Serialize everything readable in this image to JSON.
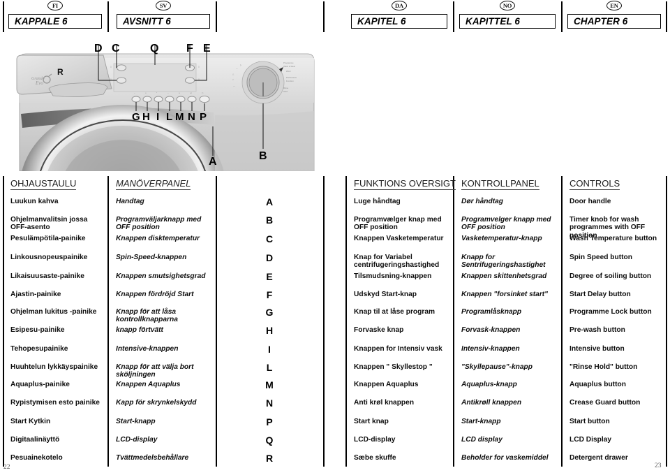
{
  "languages": [
    {
      "code": "FI",
      "title": "KAPPALE 6"
    },
    {
      "code": "SV",
      "title": "AVSNITT 6"
    },
    {
      "code": "DA",
      "title": "KAPITEL 6"
    },
    {
      "code": "NO",
      "title": "KAPITTEL 6"
    },
    {
      "code": "EN",
      "title": "CHAPTER 6"
    }
  ],
  "illustration": {
    "alt_name": "washing-machine-control-panel",
    "brand_label": "Grando Evo",
    "callouts": [
      "D",
      "C",
      "Q",
      "F",
      "E",
      "R",
      "G",
      "H",
      "I",
      "L",
      "M",
      "N",
      "P",
      "B",
      "A"
    ]
  },
  "section_headers": {
    "fi": "OHJAUSTAULU",
    "sv": "MANÖVERPANEL",
    "da": "FUNKTIONS OVERSIGT",
    "no": "KONTROLLPANEL",
    "en": "CONTROLS"
  },
  "letters": [
    "A",
    "B",
    "C",
    "D",
    "E",
    "F",
    "G",
    "H",
    "I",
    "L",
    "M",
    "N",
    "P",
    "Q",
    "R"
  ],
  "rows": [
    {
      "letter": "A",
      "fi": "Luukun kahva",
      "sv": "Handtag",
      "da": "Luge håndtag",
      "no": "Dør håndtag",
      "en": "Door handle"
    },
    {
      "letter": "B",
      "fi": "Ohjelmanvalitsin jossa OFF-asento",
      "sv": "Programväljarknapp med OFF position",
      "da": "Programvælger knap med OFF position",
      "no": "Programvelger knapp med OFF position",
      "en": "Timer knob for wash programmes with OFF position"
    },
    {
      "letter": "C",
      "fi": "Pesulämpötila-painike",
      "sv": "Knappen disktemperatur",
      "da": "Knappen Vasketemperatur",
      "no": "Vasketemperatur-knapp",
      "en": "Wash Temperature button"
    },
    {
      "letter": "D",
      "fi": "Linkousnopeuspainike",
      "sv": "Spin-Speed-knappen",
      "da": "Knap for Variabel centrifugeringshastighed",
      "no": "Knapp for Sentrifugeringshastighet",
      "en": "Spin Speed button"
    },
    {
      "letter": "E",
      "fi": "Likaisuusaste-painike",
      "sv": "Knappen smutsighetsgrad",
      "da": "Tilsmudsning-knappen",
      "no": "Knappen skittenhetsgrad",
      "en": "Degree of soiling button"
    },
    {
      "letter": "F",
      "fi": "Ajastin-painike",
      "sv": "Knappen fördröjd Start",
      "da": "Udskyd Start-knap",
      "no": "Knappen \"forsinket start\"",
      "en": "Start Delay button"
    },
    {
      "letter": "G",
      "fi": "Ohjelman lukitus -painike",
      "sv": "Knapp för att låsa kontrollknapparna",
      "da": "Knap til at låse program",
      "no": "Programlåsknapp",
      "en": "Programme Lock button"
    },
    {
      "letter": "H",
      "fi": "Esipesu-painike",
      "sv": "knapp förtvätt",
      "da": "Forvaske knap",
      "no": "Forvask-knappen",
      "en": "Pre-wash button"
    },
    {
      "letter": "I",
      "fi": "Tehopesupainike",
      "sv": "Intensive-knappen",
      "da": "Knappen for Intensiv vask",
      "no": "Intensiv-knappen",
      "en": "Intensive button"
    },
    {
      "letter": "L",
      "fi": "Huuhtelun lykkäyspainike",
      "sv": "Knapp för att välja bort sköljningen",
      "da": "Knappen \" Skyllestop \"",
      "no": "\"Skyllepause\"-knapp",
      "en": "\"Rinse Hold\" button"
    },
    {
      "letter": "M",
      "fi": "Aquaplus-painike",
      "sv": "Knappen Aquaplus",
      "da": "Knappen Aquaplus",
      "no": "Aquaplus-knapp",
      "en": "Aquaplus button"
    },
    {
      "letter": "N",
      "fi": "Rypistymisen esto painike",
      "sv": "Kapp för skrynkelskydd",
      "da": "Anti krøl knappen",
      "no": "Antikrøll knappen",
      "en": "Crease Guard button"
    },
    {
      "letter": "P",
      "fi": "Start Kytkin",
      "sv": "Start-knapp",
      "da": "Start knap",
      "no": "Start-knapp",
      "en": "Start button"
    },
    {
      "letter": "Q",
      "fi": "Digitaalinäyttö",
      "sv": "LCD-display",
      "da": "LCD-display",
      "no": "LCD display",
      "en": "LCD Display"
    },
    {
      "letter": "R",
      "fi": "Pesuainekotelo",
      "sv": "Tvättmedelsbehållare",
      "da": "Sæbe skuffe",
      "no": "Beholder for vaskemiddel",
      "en": "Detergent drawer"
    }
  ],
  "page_numbers": {
    "left": "22",
    "right": "23"
  }
}
